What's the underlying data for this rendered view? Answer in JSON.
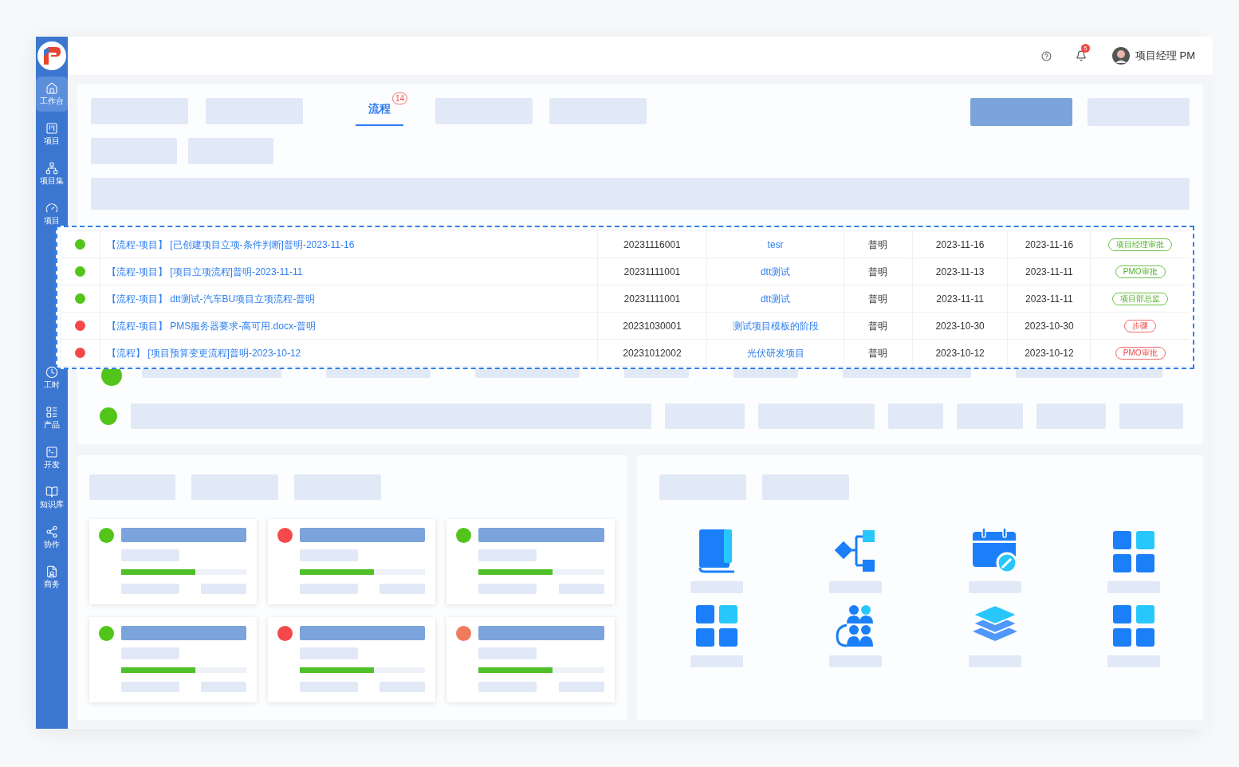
{
  "sidebar": {
    "items": [
      {
        "label": "工作台",
        "selected": true
      },
      {
        "label": "项目",
        "selected": false
      },
      {
        "label": "项目集",
        "selected": false
      },
      {
        "label": "项目",
        "selected": false
      },
      {
        "label": "工时",
        "selected": false
      },
      {
        "label": "产品",
        "selected": false
      },
      {
        "label": "开发",
        "selected": false
      },
      {
        "label": "知识库",
        "selected": false
      },
      {
        "label": "协作",
        "selected": false
      },
      {
        "label": "商务",
        "selected": false
      }
    ]
  },
  "header": {
    "notification_count": "5",
    "user_name": "项目经理 PM"
  },
  "tabs": [
    {
      "label": "流程",
      "selected": true,
      "badge": "14"
    }
  ],
  "list_rows": [
    {
      "color": "#52c41a"
    },
    {
      "color": "#52c41a"
    }
  ],
  "table": {
    "rows": [
      {
        "color": "#52c41a",
        "title": "【流程-项目】 [已创建项目立项-条件判断]普明-2023-11-16",
        "number": "20231116001",
        "project": "tesr",
        "creator": "普明",
        "start": "2023-11-16",
        "end": "2023-11-16",
        "status": "项目经理审批",
        "overdue": false
      },
      {
        "color": "#52c41a",
        "title": "【流程-项目】 [项目立项流程]普明-2023-11-11",
        "number": "20231111001",
        "project": "dtt测试",
        "creator": "普明",
        "start": "2023-11-13",
        "end": "2023-11-11",
        "status": "PMO审批",
        "overdue": false
      },
      {
        "color": "#52c41a",
        "title": "【流程-项目】 dtt测试-汽车BU项目立项流程-普明",
        "number": "20231111001",
        "project": "dtt测试",
        "creator": "普明",
        "start": "2023-11-11",
        "end": "2023-11-11",
        "status": "项目部总监",
        "overdue": false
      },
      {
        "color": "#f5484a",
        "title": "【流程-项目】 PMS服务器要求-高可用.docx-普明",
        "number": "20231030001",
        "project": "测试项目模板的阶段",
        "creator": "普明",
        "start": "2023-10-30",
        "end": "2023-10-30",
        "status": "步骤",
        "overdue": true
      },
      {
        "color": "#f5484a",
        "title": "【流程】 [项目预算变更流程]普明-2023-10-12",
        "number": "20231012002",
        "project": "光伏研发项目",
        "creator": "普明",
        "start": "2023-10-12",
        "end": "2023-10-12",
        "status": "PMO审批",
        "overdue": true
      }
    ]
  },
  "cards": [
    {
      "color": "#52c41a",
      "level": 0.59
    },
    {
      "color": "#f5484a",
      "level": 0.59
    },
    {
      "color": "#52c41a",
      "level": 0.59
    },
    {
      "color": "#52c41a",
      "level": 0.59
    },
    {
      "color": "#f5484a",
      "level": 0.59
    },
    {
      "color": "#f07c5c",
      "level": 0.59
    }
  ],
  "apps": [
    {
      "kind": "book"
    },
    {
      "kind": "flow"
    },
    {
      "kind": "calendar"
    },
    {
      "kind": "grid"
    },
    {
      "kind": "grid"
    },
    {
      "kind": "team"
    },
    {
      "kind": "layers"
    },
    {
      "kind": "grid"
    }
  ]
}
